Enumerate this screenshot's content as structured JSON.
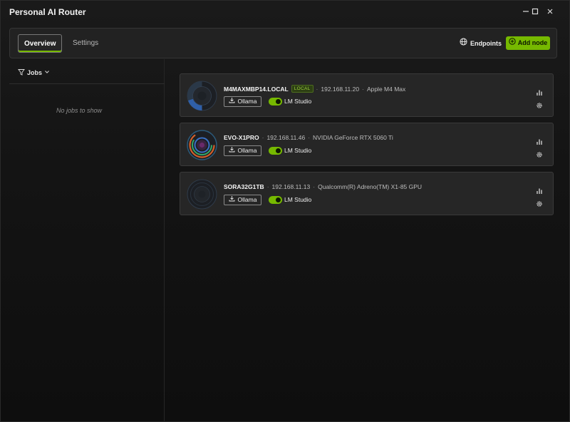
{
  "window": {
    "title": "Personal AI Router",
    "controls": [
      "minimize-icon",
      "maximize-icon",
      "close-icon"
    ]
  },
  "toolbar": {
    "tabs": [
      {
        "label": "Overview",
        "active": true
      },
      {
        "label": "Settings",
        "active": false
      }
    ],
    "endpoints_label": "Endpoints",
    "add_node_label": "Add node"
  },
  "sidebar": {
    "jobs_label": "Jobs",
    "empty_text": "No jobs to show"
  },
  "nodes": [
    {
      "name": "M4MAXMBP14.LOCAL",
      "badge": "LOCAL",
      "ip": "192.168.11.20",
      "gpu": "Apple M4 Max",
      "ollama_label": "Ollama",
      "lm_label": "LM Studio",
      "lm_enabled": true
    },
    {
      "name": "EVO-X1PRO",
      "badge": "",
      "ip": "192.168.11.46",
      "gpu": "NVIDIA GeForce RTX 5060 Ti",
      "ollama_label": "Ollama",
      "lm_label": "LM Studio",
      "lm_enabled": true
    },
    {
      "name": "SORA32G1TB",
      "badge": "",
      "ip": "192.168.11.13",
      "gpu": "Qualcomm(R) Adreno(TM) X1-85 GPU",
      "ollama_label": "Ollama",
      "lm_label": "LM Studio",
      "lm_enabled": true
    }
  ],
  "colors": {
    "accent": "#76b900",
    "background": "#111111",
    "card": "#262626"
  },
  "icons": {
    "endpoints": "globe-icon",
    "add_node": "plus-circle-icon",
    "jobs": "filter-icon",
    "ollama": "download-icon",
    "stats": "bar-chart-icon",
    "settings": "gear-icon"
  }
}
